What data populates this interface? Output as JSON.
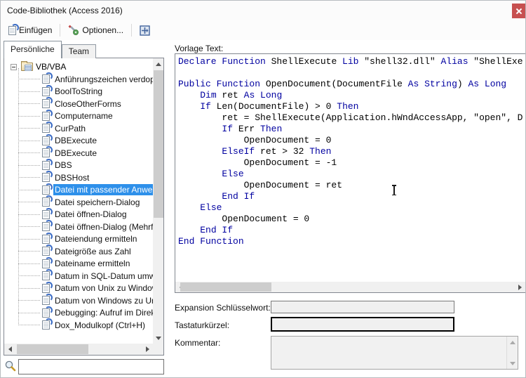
{
  "window": {
    "title": "Code-Bibliothek (Access 2016)"
  },
  "toolbar": {
    "insert_label": "Einfügen",
    "options_label": "Optionen..."
  },
  "tabs": [
    {
      "label": "Persönliche",
      "active": true
    },
    {
      "label": "Team",
      "active": false
    }
  ],
  "tree": {
    "root": "VB/VBA",
    "selected_index": 9,
    "items": [
      {
        "label": "Anführungszeichen verdopp",
        "selected": false
      },
      {
        "label": "BoolToString",
        "selected": false
      },
      {
        "label": "CloseOtherForms",
        "selected": false
      },
      {
        "label": "Computername",
        "selected": false
      },
      {
        "label": "CurPath",
        "selected": false
      },
      {
        "label": "DBExecute",
        "selected": false
      },
      {
        "label": "DBExecute",
        "selected": false
      },
      {
        "label": "DBS",
        "selected": false
      },
      {
        "label": "DBSHost",
        "selected": false
      },
      {
        "label": "Datei mit passender Anwend",
        "selected": true
      },
      {
        "label": "Datei speichern-Dialog",
        "selected": false
      },
      {
        "label": "Datei öffnen-Dialog",
        "selected": false
      },
      {
        "label": "Datei öffnen-Dialog (Mehrfac",
        "selected": false
      },
      {
        "label": "Dateiendung ermitteln",
        "selected": false
      },
      {
        "label": "Dateigröße aus Zahl",
        "selected": false
      },
      {
        "label": "Dateiname ermitteln",
        "selected": false
      },
      {
        "label": "Datum in SQL-Datum umwan",
        "selected": false
      },
      {
        "label": "Datum von Unix zu Windows",
        "selected": false
      },
      {
        "label": "Datum von Windows zu Unix",
        "selected": false
      },
      {
        "label": "Debugging: Aufruf im Direktf",
        "selected": false
      },
      {
        "label": "Dox_Modulkopf (Ctrl+H)",
        "selected": false
      }
    ]
  },
  "search": {
    "value": ""
  },
  "editor": {
    "label": "Vorlage Text:",
    "lines": [
      [
        {
          "t": "Declare Function",
          "k": true
        },
        {
          "t": " ShellExecute ",
          "k": false
        },
        {
          "t": "Lib",
          "k": true
        },
        {
          "t": " \"shell32.dll\" ",
          "k": false
        },
        {
          "t": "Alias",
          "k": true
        },
        {
          "t": " \"ShellExe",
          "k": false
        }
      ],
      [],
      [
        {
          "t": "Public Function",
          "k": true
        },
        {
          "t": " OpenDocument(DocumentFile ",
          "k": false
        },
        {
          "t": "As String",
          "k": true
        },
        {
          "t": ") ",
          "k": false
        },
        {
          "t": "As Long",
          "k": true
        }
      ],
      [
        {
          "t": "    ",
          "k": false
        },
        {
          "t": "Dim",
          "k": true
        },
        {
          "t": " ret ",
          "k": false
        },
        {
          "t": "As Long",
          "k": true
        }
      ],
      [
        {
          "t": "    ",
          "k": false
        },
        {
          "t": "If",
          "k": true
        },
        {
          "t": " Len(DocumentFile) > 0 ",
          "k": false
        },
        {
          "t": "Then",
          "k": true
        }
      ],
      [
        {
          "t": "        ret = ShellExecute(Application.hWndAccessApp, \"open\", D",
          "k": false
        }
      ],
      [
        {
          "t": "        ",
          "k": false
        },
        {
          "t": "If",
          "k": true
        },
        {
          "t": " Err ",
          "k": false
        },
        {
          "t": "Then",
          "k": true
        }
      ],
      [
        {
          "t": "            OpenDocument = 0",
          "k": false
        }
      ],
      [
        {
          "t": "        ",
          "k": false
        },
        {
          "t": "ElseIf",
          "k": true
        },
        {
          "t": " ret > 32 ",
          "k": false
        },
        {
          "t": "Then",
          "k": true
        }
      ],
      [
        {
          "t": "            OpenDocument = -1",
          "k": false
        }
      ],
      [
        {
          "t": "        ",
          "k": false
        },
        {
          "t": "Else",
          "k": true
        }
      ],
      [
        {
          "t": "            OpenDocument = ret",
          "k": false
        }
      ],
      [
        {
          "t": "        ",
          "k": false
        },
        {
          "t": "End If",
          "k": true
        }
      ],
      [
        {
          "t": "    ",
          "k": false
        },
        {
          "t": "Else",
          "k": true
        }
      ],
      [
        {
          "t": "        OpenDocument = 0",
          "k": false
        }
      ],
      [
        {
          "t": "    ",
          "k": false
        },
        {
          "t": "End If",
          "k": true
        }
      ],
      [
        {
          "t": "End Function",
          "k": true
        }
      ]
    ]
  },
  "fields": {
    "expansion_label": "Expansion Schlüsselwort:",
    "expansion_value": "",
    "shortcut_label": "Tastaturkürzel:",
    "shortcut_value": "",
    "comment_label": "Kommentar:",
    "comment_value": ""
  },
  "colors": {
    "keyword": "#0000A0",
    "selection_bg": "#2E90EA",
    "selection_text": "#FFFFFF",
    "close_button": "#C75050"
  },
  "icons": {
    "toolbar": [
      "insert-page-icon",
      "tools-wrench-icon",
      "dock-window-icon"
    ],
    "tree_root": "folder-icon",
    "tree_item": "code-snippet-icon",
    "search": "magnifier-icon",
    "pointer": "ibeam-cursor"
  }
}
